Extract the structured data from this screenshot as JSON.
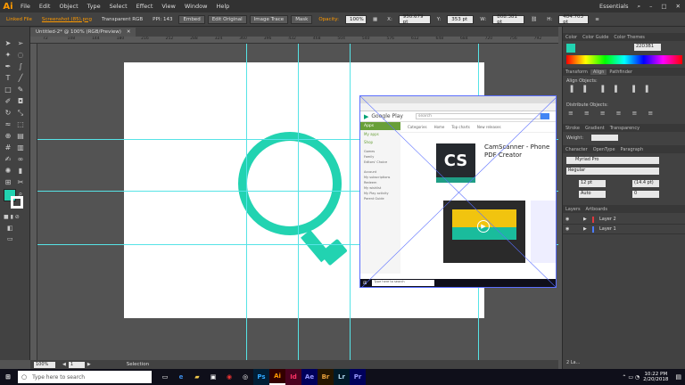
{
  "app": {
    "logo": "Ai"
  },
  "menu": [
    "File",
    "Edit",
    "Object",
    "Type",
    "Select",
    "Effect",
    "View",
    "Window",
    "Help"
  ],
  "workspace": "Essentials",
  "control": {
    "unlinked": "Linked File",
    "filename": "Screenshot (85).png",
    "mode": "Transparent RGB",
    "ppi": "PPI: 143",
    "embed": "Embed",
    "edit_original": "Edit Original",
    "image_trace": "Image Trace",
    "mask": "Mask",
    "opacity_label": "Opacity:",
    "opacity": "100%",
    "x": "950.679 pt",
    "y": "353 pt",
    "w": "808.381 pt",
    "h": "484.703 pt"
  },
  "doc_tab": "Untitled-2* @ 100% (RGB/Preview)",
  "ruler_ticks": [
    "72",
    "108",
    "144",
    "180",
    "216",
    "252",
    "288",
    "324",
    "360",
    "396",
    "432",
    "468",
    "504",
    "540",
    "576",
    "612",
    "648",
    "684",
    "720",
    "756",
    "792"
  ],
  "status": {
    "zoom": "100%",
    "page": "1",
    "tool": "Selection"
  },
  "color_panel": {
    "tabs": [
      "Color",
      "Color Guide",
      "Color Themes"
    ],
    "hex": "22D3B1"
  },
  "align_panel": {
    "tabs": [
      "Transform",
      "Align",
      "Pathfinder"
    ],
    "align_objects": "Align Objects:",
    "distribute_objects": "Distribute Objects:"
  },
  "stroke_panel": {
    "tabs": [
      "Stroke",
      "Gradient",
      "Transparency"
    ],
    "weight_label": "Weight:"
  },
  "character_panel": {
    "tabs": [
      "Character",
      "OpenType",
      "Paragraph"
    ],
    "font": "Myriad Pro",
    "style": "Regular",
    "size": "12 pt",
    "leading": "(14.4 pt)",
    "kerning": "Auto",
    "tracking": "0"
  },
  "layers_panel": {
    "tabs": [
      "Layers",
      "Artboards"
    ],
    "layers": [
      {
        "name": "Layer 2",
        "color": "#e0393e"
      },
      {
        "name": "Layer 1",
        "color": "#4b7bff"
      }
    ],
    "footer": "2 La..."
  },
  "embedded_screenshot": {
    "store": "Google Play",
    "search": "search",
    "apps": "Apps",
    "my_apps": "My apps",
    "shop": "Shop",
    "cats": [
      "Games",
      "Family",
      "Editors' Choice"
    ],
    "account": [
      "Account",
      "My subscriptions",
      "Redeem",
      "My wishlist",
      "My Play activity",
      "Parent Guide"
    ],
    "top_tabs": [
      "Categories",
      "Home",
      "Top charts",
      "New releases"
    ],
    "app_title": "CamScanner - Phone PDF Creator",
    "app_icon": "CS",
    "taskbar_search": "Type here to search"
  },
  "accent_color": "#22d3b1",
  "taskbar": {
    "search_placeholder": "Type here to search",
    "time": "10:22 PM",
    "date": "2/20/2018",
    "apps": [
      "Ps",
      "Ai",
      "Id",
      "Ae",
      "Br",
      "Lr",
      "Pr"
    ]
  }
}
